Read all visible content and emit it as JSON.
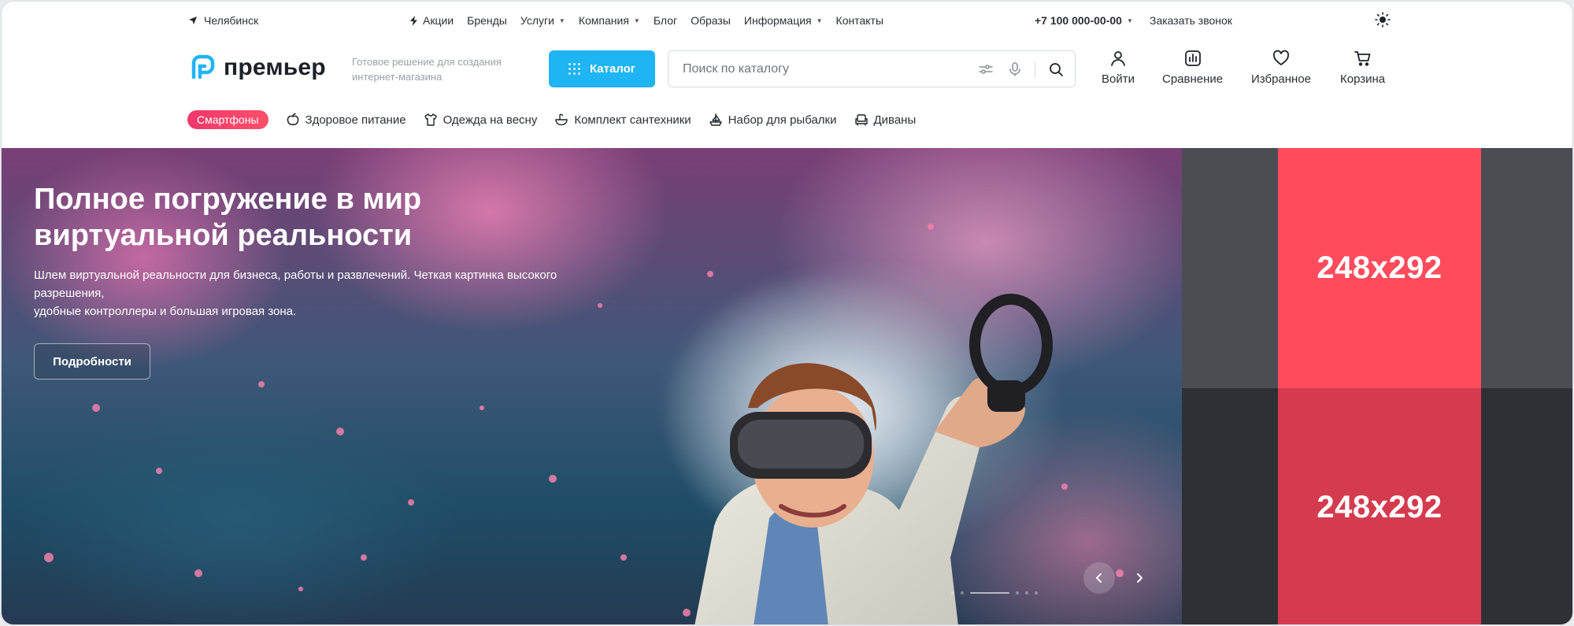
{
  "topbar": {
    "city": "Челябинск",
    "nav": [
      {
        "label": "Акции",
        "icon": "lightning-icon"
      },
      {
        "label": "Бренды"
      },
      {
        "label": "Услуги",
        "dropdown": true
      },
      {
        "label": "Компания",
        "dropdown": true
      },
      {
        "label": "Блог"
      },
      {
        "label": "Образы"
      },
      {
        "label": "Информация",
        "dropdown": true
      },
      {
        "label": "Контакты"
      }
    ],
    "phone": "+7 100 000-00-00",
    "callback": "Заказать звонок"
  },
  "header": {
    "logo": "премьер",
    "tagline": "Готовое решение для создания интернет-магазина",
    "catalog_button": "Каталог",
    "search_placeholder": "Поиск по каталогу",
    "actions": {
      "login": "Войти",
      "compare": "Сравнение",
      "favorites": "Избранное",
      "cart": "Корзина"
    }
  },
  "categories": [
    {
      "label": "Смартфоны",
      "active": true
    },
    {
      "label": "Здоровое питание",
      "icon": "apple-icon"
    },
    {
      "label": "Одежда на весну",
      "icon": "shirt-icon"
    },
    {
      "label": "Комплект сантехники",
      "icon": "sink-icon"
    },
    {
      "label": "Набор для рыбалки",
      "icon": "boat-icon"
    },
    {
      "label": "Диваны",
      "icon": "sofa-icon"
    }
  ],
  "hero": {
    "title": "Полное погружение в мир виртуальной реальности",
    "text_lines": [
      "Шлем виртуальной реальности для бизнеса, работы и развлечений. Четкая картинка высокого разрешения,",
      "удобные контроллеры и большая игровая зона."
    ],
    "button": "Подробности",
    "slides_count": 6,
    "active_slide": 2
  },
  "banners": [
    {
      "label": "248x292"
    },
    {
      "label": "248x292"
    }
  ],
  "colors": {
    "accent_blue": "#1fb4f4",
    "accent_pink": "#ff4b5c",
    "text_dark": "#1f2329"
  }
}
